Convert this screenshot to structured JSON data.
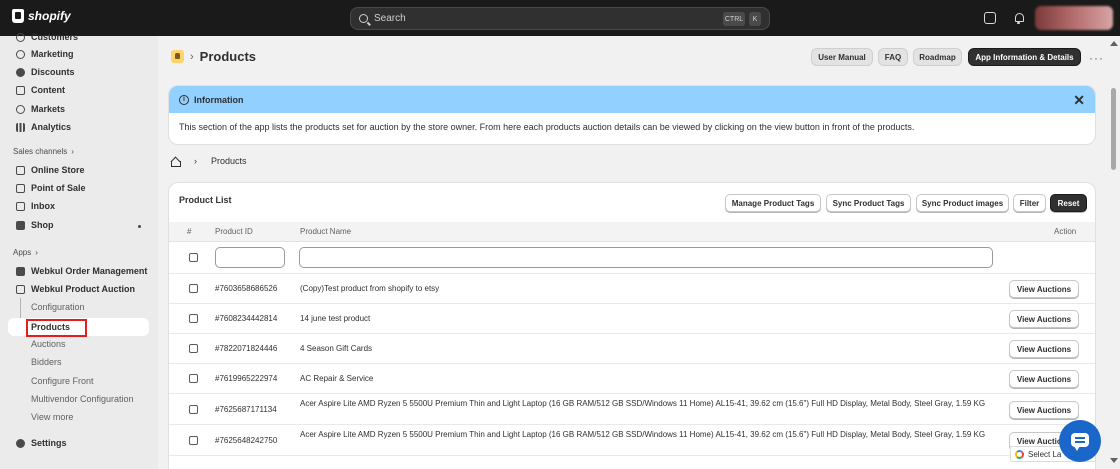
{
  "topbar": {
    "brand": "shopify",
    "search_placeholder": "Search",
    "shortcut_ctrl": "CTRL",
    "shortcut_key": "K"
  },
  "sidebar": {
    "top_partial": "Customers",
    "main_items": [
      {
        "label": "Marketing",
        "icon": "target-icon"
      },
      {
        "label": "Discounts",
        "icon": "discount-icon"
      },
      {
        "label": "Content",
        "icon": "content-icon"
      },
      {
        "label": "Markets",
        "icon": "globe-icon"
      },
      {
        "label": "Analytics",
        "icon": "bar-chart-icon"
      }
    ],
    "sales_channels_heading": "Sales channels",
    "sales_channels": [
      {
        "label": "Online Store",
        "icon": "store-icon"
      },
      {
        "label": "Point of Sale",
        "icon": "pos-icon"
      },
      {
        "label": "Inbox",
        "icon": "inbox-icon"
      },
      {
        "label": "Shop",
        "icon": "shop-icon"
      }
    ],
    "apps_heading": "Apps",
    "apps": [
      {
        "label": "Webkul Order Management"
      },
      {
        "label": "Webkul Product Auction"
      }
    ],
    "sub_items": [
      "Configuration",
      "Products",
      "Auctions",
      "Bidders",
      "Configure Front",
      "Multivendor Configuration",
      "View more"
    ],
    "active_sub": "Products",
    "settings": "Settings"
  },
  "header": {
    "title": "Products",
    "buttons": [
      "User Manual",
      "FAQ",
      "Roadmap",
      "App Information & Details"
    ],
    "more": "···"
  },
  "info": {
    "title": "Information",
    "text": "This section of the app lists the products set for auction by the store owner. From here each products auction details can be viewed by clicking on the view button in front of the products."
  },
  "breadcrumb": {
    "current": "Products"
  },
  "product_list": {
    "title": "Product List",
    "buttons": [
      "Manage Product Tags",
      "Sync Product Tags",
      "Sync Product images",
      "Filter",
      "Reset"
    ],
    "columns": {
      "num": "#",
      "id": "Product ID",
      "name": "Product Name",
      "action": "Action"
    },
    "rows": [
      {
        "id": "#7603658686526",
        "name": "(Copy)Test product from shopify to etsy",
        "action": "View Auctions"
      },
      {
        "id": "#7608234442814",
        "name": "14 june test product",
        "action": "View Auctions"
      },
      {
        "id": "#7822071824446",
        "name": "4 Season Gift Cards",
        "action": "View Auctions"
      },
      {
        "id": "#7619965222974",
        "name": "AC Repair & Service",
        "action": "View Auctions"
      },
      {
        "id": "#7625687171134",
        "name": "Acer Aspire Lite AMD Ryzen 5 5500U Premium Thin and Light Laptop (16 GB RAM/512 GB SSD/Windows 11 Home) AL15-41, 39.62 cm (15.6\") Full HD Display, Metal Body, Steel Gray, 1.59 KG",
        "action": "View Auctions"
      },
      {
        "id": "#7625648242750",
        "name": "Acer Aspire Lite AMD Ryzen 5 5500U Premium Thin and Light Laptop (16 GB RAM/512 GB SSD/Windows 11 Home) AL15-41, 39.62 cm (15.6\") Full HD Display, Metal Body, Steel Gray, 1.59 KG",
        "action": "View Auctions"
      }
    ]
  },
  "translate": {
    "label": "Select La"
  }
}
